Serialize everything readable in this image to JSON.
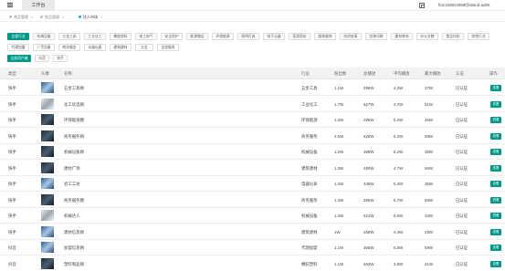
{
  "topbar": {
    "tab_label": "工作台",
    "user": "ftu2158824598f(fatland-ad68"
  },
  "crumbs": [
    {
      "label": "商品管理",
      "active": false
    },
    {
      "label": "商品管理",
      "active": false
    },
    {
      "label": "达人市场",
      "active": true
    }
  ],
  "categories": {
    "row1": [
      "全部行业",
      "机械设备",
      "五金工具",
      "工业化工",
      "橡胶塑料",
      "电工电气",
      "安全防护",
      "能源储运",
      "环保能源",
      "照明灯具",
      "电子元器",
      "家居家纺",
      "服装服饰",
      "纺织皮革",
      "包装印刷",
      "建材装饰",
      "办公文教",
      "食品饮料",
      "其他行业"
    ],
    "row2": [
      "代理加盟",
      "二手设备",
      "商务服务",
      "仪器仪表",
      "建筑建材",
      "五金",
      "全部服务"
    ],
    "row3": [
      "全部用户端",
      "抖音",
      "快手"
    ]
  },
  "table": {
    "headers": [
      "类型",
      "头像",
      "名称",
      "行业",
      "粉丝数",
      "总播放",
      "平均播放",
      "最大播放",
      "认证",
      "操作"
    ],
    "rows": [
      {
        "type": "快手",
        "name": "五金工具网",
        "industry": "五金工具",
        "fans": "1.1W",
        "total": "296W",
        "avg": "4.2W",
        "max": "37W",
        "cert": "已认证",
        "action": "查看",
        "thumb": "blue"
      },
      {
        "type": "快手",
        "name": "化工优选网",
        "industry": "工业化工",
        "fans": "1.7W",
        "total": "527W",
        "avg": "4.7W",
        "max": "51W",
        "cert": "已认证",
        "action": "查看",
        "thumb": "light"
      },
      {
        "type": "快手",
        "name": "环保能源圈",
        "industry": "环保能源",
        "fans": "1.2W",
        "total": "296W",
        "avg": "5.2W",
        "max": "46W",
        "cert": "已认证",
        "action": "查看",
        "thumb": "dark"
      },
      {
        "type": "快手",
        "name": "商务服务网",
        "industry": "商务服务",
        "fans": "2.5W",
        "total": "629W",
        "avg": "6.2W",
        "max": "59W",
        "cert": "已认证",
        "action": "查看",
        "thumb": "dark"
      },
      {
        "type": "快手",
        "name": "机械设备网",
        "industry": "机械设备",
        "fans": "1.2W",
        "total": "389W",
        "avg": "5.2W",
        "max": "36W",
        "cert": "已认证",
        "action": "查看",
        "thumb": "dark"
      },
      {
        "type": "快手",
        "name": "建材广场",
        "industry": "建筑建材",
        "fans": "1.3W",
        "total": "480W",
        "avg": "4.7W",
        "max": "66W",
        "cert": "已认证",
        "action": "查看",
        "thumb": "dark"
      },
      {
        "type": "快手",
        "name": "岩工工坊",
        "industry": "电器仪表",
        "fans": "1.2W",
        "total": "439W",
        "avg": "5.2W",
        "max": "36W",
        "cert": "已认证",
        "action": "查看",
        "thumb": "blue"
      },
      {
        "type": "快手",
        "name": "商务服务圈",
        "industry": "商务服务",
        "fans": "1.3W",
        "total": "396W",
        "avg": "6.7W",
        "max": "55W",
        "cert": "已认证",
        "action": "查看",
        "thumb": "dark"
      },
      {
        "type": "快手",
        "name": "机械达人",
        "industry": "机械设备",
        "fans": "1.2W",
        "total": "521W",
        "avg": "6.5W",
        "max": "34W",
        "cert": "已认证",
        "action": "查看",
        "thumb": "light"
      },
      {
        "type": "快手",
        "name": "建材信息网",
        "industry": "建筑建材",
        "fans": "1W",
        "total": "268W",
        "avg": "2.4W",
        "max": "25W",
        "cert": "已认证",
        "action": "查看",
        "thumb": "blue"
      },
      {
        "type": "抖音",
        "name": "加盟信息网",
        "industry": "代理加盟",
        "fans": "1.1W",
        "total": "365W",
        "avg": "6.5W",
        "max": "58W",
        "cert": "已认证",
        "action": "查看",
        "thumb": "blue"
      },
      {
        "type": "抖音",
        "name": "塑料制品网",
        "industry": "橡胶塑料",
        "fans": "1.1W",
        "total": "563W",
        "avg": "3.9W",
        "max": "41W",
        "cert": "已认证",
        "action": "查看",
        "thumb": "dark"
      }
    ]
  },
  "colors": {
    "accent": "#009688",
    "active_dot": "#1E9FFF"
  }
}
